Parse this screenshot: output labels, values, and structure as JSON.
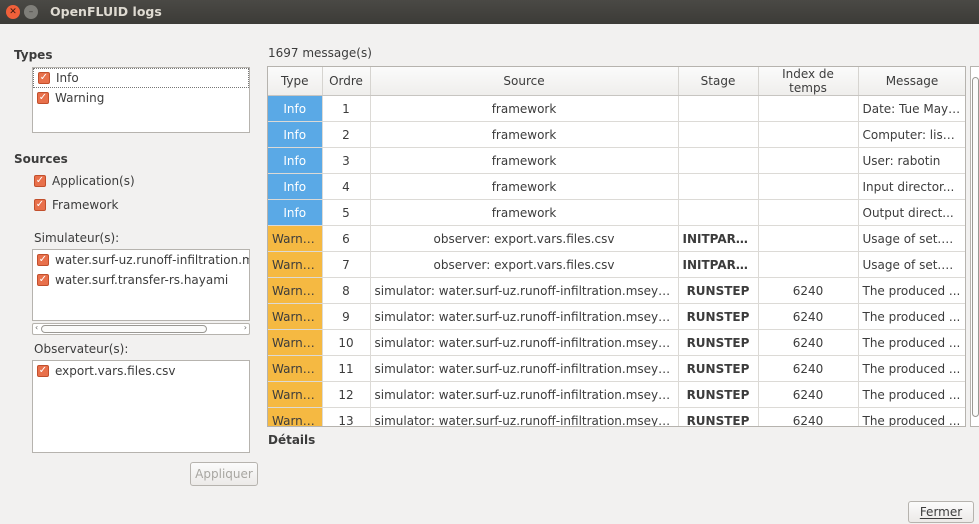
{
  "window": {
    "title": "OpenFLUID logs"
  },
  "types": {
    "label": "Types",
    "items": [
      {
        "label": "Info",
        "checked": true
      },
      {
        "label": "Warning",
        "checked": true
      }
    ]
  },
  "sources": {
    "label": "Sources",
    "application": "Application(s)",
    "framework": "Framework"
  },
  "simulators": {
    "label": "Simulateur(s):",
    "items": [
      {
        "label": "water.surf-uz.runoff-infiltration.m"
      },
      {
        "label": "water.surf.transfer-rs.hayami"
      }
    ]
  },
  "observers": {
    "label": "Observateur(s):",
    "items": [
      {
        "label": "export.vars.files.csv"
      }
    ]
  },
  "apply_button": "Appliquer",
  "close_button": "Fermer",
  "details_label": "Détails",
  "message_count": "1697 message(s)",
  "table": {
    "headers": [
      "Type",
      "Ordre",
      "Source",
      "Stage",
      "Index de temps",
      "Message"
    ],
    "rows": [
      [
        "Info",
        "1",
        "framework",
        "",
        "",
        "Date: Tue May ..."
      ],
      [
        "Info",
        "2",
        "framework",
        "",
        "",
        "Computer: lisa..."
      ],
      [
        "Info",
        "3",
        "framework",
        "",
        "",
        "User: rabotin"
      ],
      [
        "Info",
        "4",
        "framework",
        "",
        "",
        "Input director..."
      ],
      [
        "Info",
        "5",
        "framework",
        "",
        "",
        "Output direct..."
      ],
      [
        "Warning",
        "6",
        "observer: export.vars.files.csv",
        "INITPARAMS",
        "",
        "Usage of set.<..."
      ],
      [
        "Warning",
        "7",
        "observer: export.vars.files.csv",
        "INITPARAMS",
        "",
        "Usage of set.<..."
      ],
      [
        "Warning",
        "8",
        "simulator: water.surf-uz.runoff-infiltration.mseytoux",
        "RUNSTEP",
        "6240",
        "The produced ..."
      ],
      [
        "Warning",
        "9",
        "simulator: water.surf-uz.runoff-infiltration.mseytoux",
        "RUNSTEP",
        "6240",
        "The produced ..."
      ],
      [
        "Warning",
        "10",
        "simulator: water.surf-uz.runoff-infiltration.mseytoux",
        "RUNSTEP",
        "6240",
        "The produced ..."
      ],
      [
        "Warning",
        "11",
        "simulator: water.surf-uz.runoff-infiltration.mseytoux",
        "RUNSTEP",
        "6240",
        "The produced ..."
      ],
      [
        "Warning",
        "12",
        "simulator: water.surf-uz.runoff-infiltration.mseytoux",
        "RUNSTEP",
        "6240",
        "The produced ..."
      ],
      [
        "Warning",
        "13",
        "simulator: water.surf-uz.runoff-infiltration.mseytoux",
        "RUNSTEP",
        "6240",
        "The produced ..."
      ]
    ]
  },
  "colors": {
    "info": "#5aa9e6",
    "warning": "#f5b942",
    "checkbox": "#e8704b"
  }
}
